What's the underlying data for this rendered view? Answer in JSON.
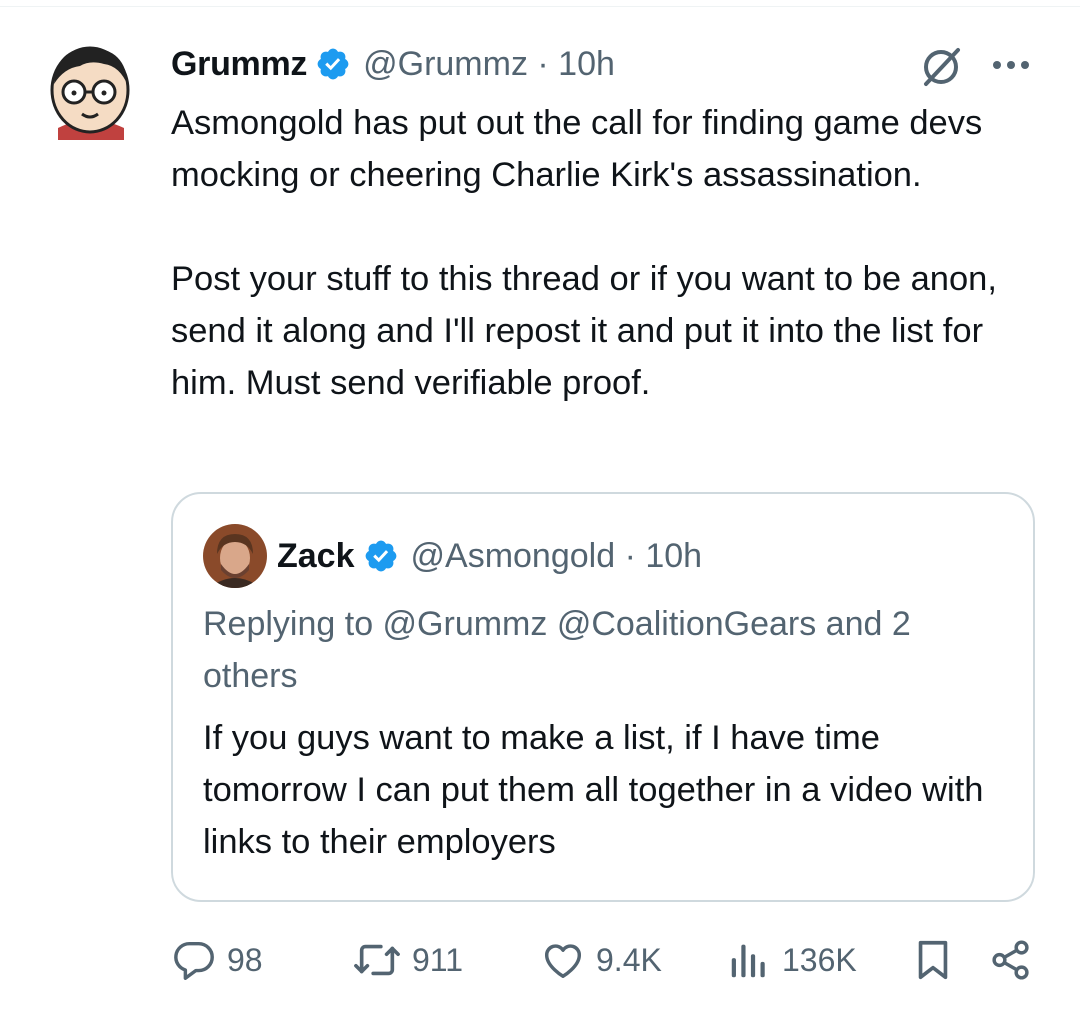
{
  "tweet": {
    "author": {
      "name": "Grummz",
      "handle": "@Grummz",
      "time": "10h"
    },
    "paragraphs": [
      "Asmongold has put out the call for finding game devs mocking or cheering Charlie Kirk's assassination.",
      "Post your stuff to this thread or if you want to be anon, send it along and I'll repost it and put it into the list for him. Must send verifiable proof."
    ]
  },
  "quoted": {
    "author": {
      "name": "Zack",
      "handle": "@Asmongold",
      "time": "10h"
    },
    "replying_to": "Replying to @Grummz @CoalitionGears and 2 others",
    "text": "If you guys want to make a list, if I have time tomorrow I can put them all together in a video with links to their employers"
  },
  "stats": {
    "replies": "98",
    "reposts": "911",
    "likes": "9.4K",
    "views": "136K"
  },
  "icons": {
    "verified": "verified-badge-icon",
    "grok": "grok-icon",
    "more": "more-icon",
    "reply": "reply-icon",
    "repost": "repost-icon",
    "like": "like-icon",
    "views": "views-icon",
    "bookmark": "bookmark-icon",
    "share": "share-icon"
  },
  "colors": {
    "text": "#0f1419",
    "secondary": "#536471",
    "border": "#cfd9de",
    "verified": "#1d9bf0"
  },
  "separator": " · "
}
